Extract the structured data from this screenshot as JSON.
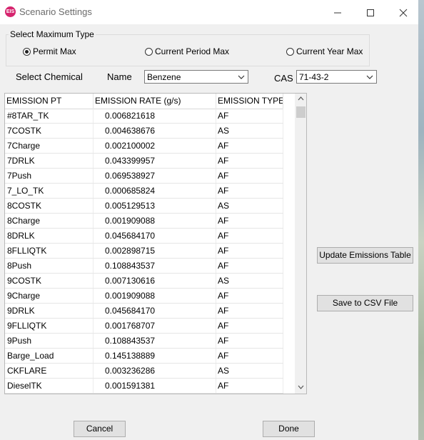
{
  "window": {
    "title": "Scenario Settings",
    "app_logo_text": "EIS",
    "controls": [
      "minimize-icon",
      "maximize-icon",
      "close-icon"
    ]
  },
  "max_type": {
    "legend": "Select Maximum Type",
    "options": [
      {
        "label": "Permit Max",
        "selected": true
      },
      {
        "label": "Current Period Max",
        "selected": false
      },
      {
        "label": "Current Year Max",
        "selected": false
      }
    ]
  },
  "chemical": {
    "label": "Select Chemical",
    "name_label": "Name",
    "name_value": "Benzene",
    "cas_label": "CAS",
    "cas_value": "71-43-2"
  },
  "table": {
    "columns": [
      "EMISSION PT",
      "EMISSION RATE (g/s)",
      "EMISSION TYPE"
    ],
    "rows": [
      [
        "#8TAR_TK",
        "0.006821618",
        "AF"
      ],
      [
        "7COSTK",
        "0.004638676",
        "AS"
      ],
      [
        "7Charge",
        "0.002100002",
        "AF"
      ],
      [
        "7DRLK",
        "0.043399957",
        "AF"
      ],
      [
        "7Push",
        "0.069538927",
        "AF"
      ],
      [
        "7_LO_TK",
        "0.000685824",
        "AF"
      ],
      [
        "8COSTK",
        "0.005129513",
        "AS"
      ],
      [
        "8Charge",
        "0.001909088",
        "AF"
      ],
      [
        "8DRLK",
        "0.045684170",
        "AF"
      ],
      [
        "8FLLIQTK",
        "0.002898715",
        "AF"
      ],
      [
        "8Push",
        "0.108843537",
        "AF"
      ],
      [
        "9COSTK",
        "0.007130616",
        "AS"
      ],
      [
        "9Charge",
        "0.001909088",
        "AF"
      ],
      [
        "9DRLK",
        "0.045684170",
        "AF"
      ],
      [
        "9FLLIQTK",
        "0.001768707",
        "AF"
      ],
      [
        "9Push",
        "0.108843537",
        "AF"
      ],
      [
        "Barge_Load",
        "0.145138889",
        "AF"
      ],
      [
        "CKFLARE",
        "0.003236286",
        "AS"
      ],
      [
        "DieselTK",
        "0.001591381",
        "AF"
      ]
    ]
  },
  "buttons": {
    "update": "Update Emissions Table",
    "save_csv": "Save to CSV File",
    "cancel": "Cancel",
    "done": "Done"
  }
}
